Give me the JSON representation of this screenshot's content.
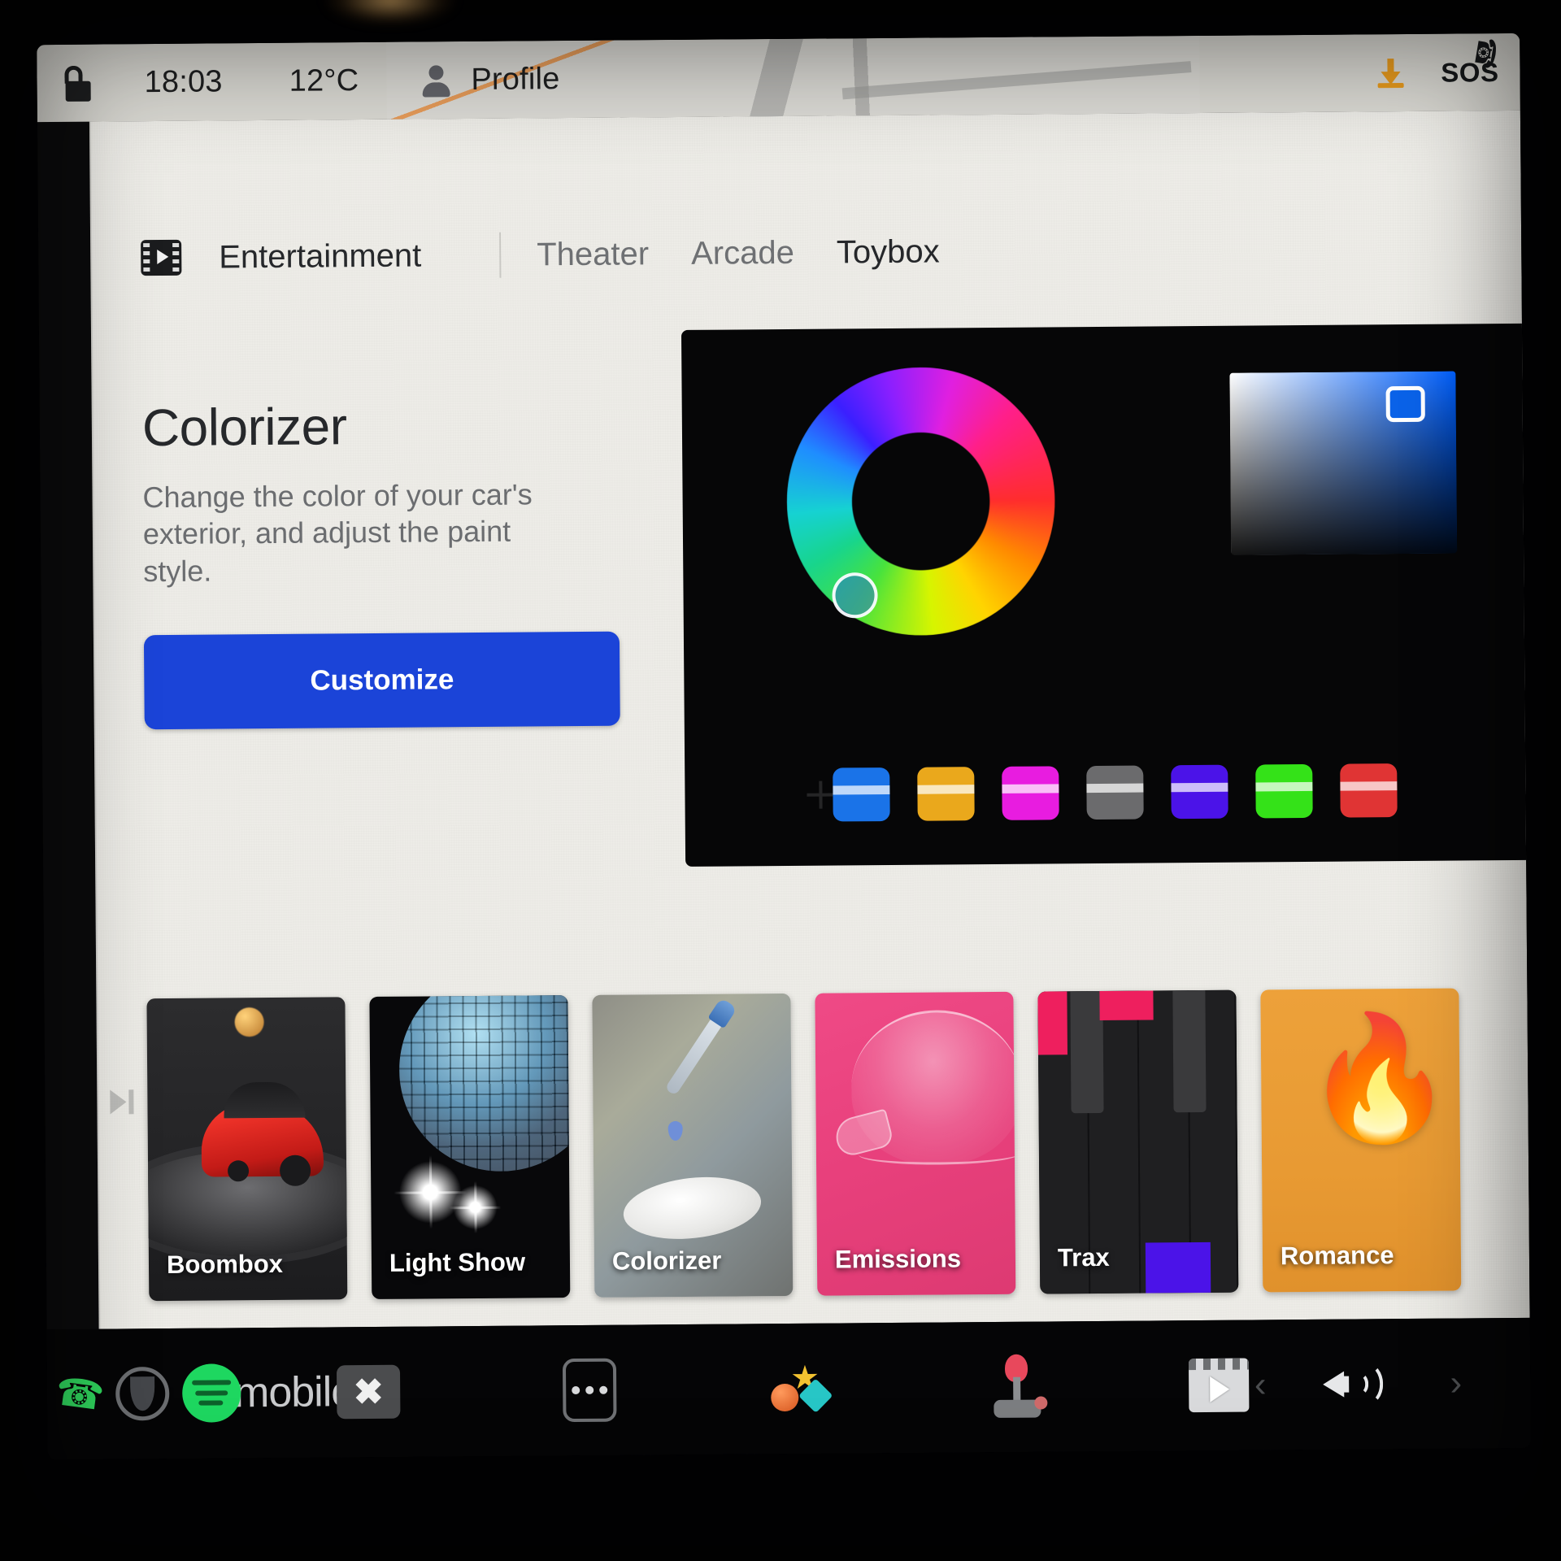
{
  "status_bar": {
    "lock_icon": "unlocked-padlock-icon",
    "time": "18:03",
    "temperature": "12°C",
    "profile_label": "Profile",
    "profile_icon": "person-icon",
    "download_icon": "download-arrow-icon",
    "sos_label": "SOS",
    "sos_icon": "phone-icon"
  },
  "tabs": {
    "app_icon": "film-strip-play-icon",
    "app_label": "Entertainment",
    "items": [
      {
        "label": "Theater",
        "selected": false
      },
      {
        "label": "Arcade",
        "selected": false
      },
      {
        "label": "Toybox",
        "selected": true
      }
    ]
  },
  "hero": {
    "title": "Colorizer",
    "description": "Change the color of your car's exterior, and adjust the paint style.",
    "button_label": "Customize",
    "button_color": "#1b44d8"
  },
  "preview": {
    "hue_wheel_icon": "color-hue-wheel",
    "hue_knob_icon": "hue-selector-knob",
    "sv_square_icon": "saturation-brightness-square",
    "sv_knob_icon": "sv-selector-knob",
    "add_swatch_icon": "plus-icon",
    "swatches": [
      {
        "name": "blue",
        "color": "#1a73e8"
      },
      {
        "name": "gold",
        "color": "#eaa81c"
      },
      {
        "name": "magenta",
        "color": "#e81ce0"
      },
      {
        "name": "gray",
        "color": "#6b6b6d"
      },
      {
        "name": "violet",
        "color": "#4b13e8"
      },
      {
        "name": "green",
        "color": "#34e218"
      },
      {
        "name": "red",
        "color": "#e03434"
      }
    ]
  },
  "cards": [
    {
      "label": "Boombox",
      "icon": "red-car-turntable-icon"
    },
    {
      "label": "Light Show",
      "icon": "disco-ball-icon"
    },
    {
      "label": "Colorizer",
      "icon": "eyedropper-paint-icon"
    },
    {
      "label": "Emissions",
      "icon": "whoopee-cushion-icon"
    },
    {
      "label": "Trax",
      "icon": "piano-keys-icon"
    },
    {
      "label": "Romance",
      "icon": "campfire-icon"
    }
  ],
  "side_control": {
    "skip_icon": "skip-next-icon"
  },
  "taskbar": {
    "phone_icon": "phone-call-icon",
    "media_ring_icon": "media-control-ring-icon",
    "music_icon": "music-app-icon",
    "brand_label": "mobilox",
    "camera_icon": "dashcam-icon",
    "more_icon": "three-dots-icon",
    "toybox_icon": "toybox-icon",
    "arcade_icon": "joystick-arcade-icon",
    "theater_icon": "film-strip-play-icon",
    "prev_icon": "chevron-left-icon",
    "volume_icon": "volume-speaker-icon",
    "next_icon": "chevron-right-icon"
  }
}
